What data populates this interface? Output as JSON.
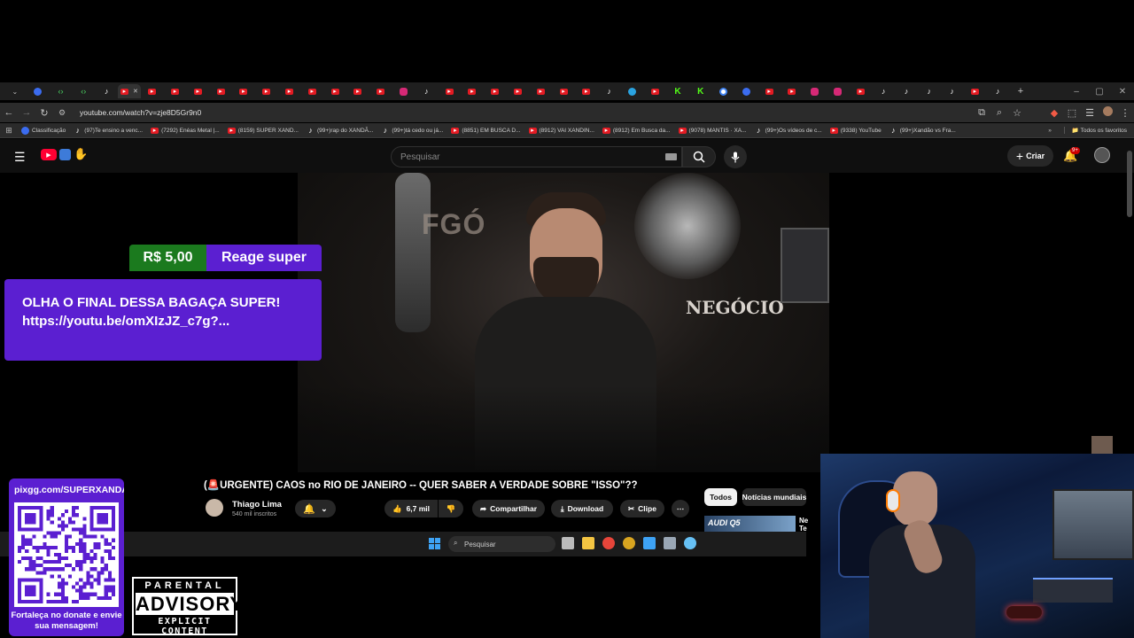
{
  "browser": {
    "tabs": [
      {
        "icon": "chrome-app-icon"
      },
      {
        "icon": "code-icon"
      },
      {
        "icon": "code-icon"
      },
      {
        "icon": "tiktok-icon"
      },
      {
        "icon": "youtube-icon",
        "active": true
      },
      {
        "icon": "youtube-icon"
      },
      {
        "icon": "youtube-icon"
      },
      {
        "icon": "youtube-icon"
      },
      {
        "icon": "youtube-icon"
      },
      {
        "icon": "youtube-icon"
      },
      {
        "icon": "youtube-icon"
      },
      {
        "icon": "youtube-icon"
      },
      {
        "icon": "youtube-icon"
      },
      {
        "icon": "youtube-icon"
      },
      {
        "icon": "youtube-icon"
      },
      {
        "icon": "youtube-icon"
      },
      {
        "icon": "instagram-icon"
      },
      {
        "icon": "tiktok-icon"
      },
      {
        "icon": "youtube-icon"
      },
      {
        "icon": "youtube-icon"
      },
      {
        "icon": "youtube-icon"
      },
      {
        "icon": "youtube-icon"
      },
      {
        "icon": "youtube-icon"
      },
      {
        "icon": "youtube-icon"
      },
      {
        "icon": "youtube-icon"
      },
      {
        "icon": "tiktok-icon"
      },
      {
        "icon": "telegram-icon"
      },
      {
        "icon": "youtube-icon"
      },
      {
        "icon": "kick-icon"
      },
      {
        "icon": "kick-icon"
      },
      {
        "icon": "google-icon"
      },
      {
        "icon": "blue-icon"
      },
      {
        "icon": "youtube-icon"
      },
      {
        "icon": "youtube-icon"
      },
      {
        "icon": "instagram-icon"
      },
      {
        "icon": "instagram-icon"
      },
      {
        "icon": "youtube-icon"
      },
      {
        "icon": "tiktok-icon"
      },
      {
        "icon": "tiktok-icon"
      },
      {
        "icon": "tiktok-icon"
      },
      {
        "icon": "tiktok-icon"
      },
      {
        "icon": "youtube-icon"
      },
      {
        "icon": "tiktok-icon"
      }
    ],
    "url": "youtube.com/watch?v=zje8D5Gr9n0",
    "bookmarks": [
      {
        "icon": "chrome-app-icon",
        "label": "Classificação"
      },
      {
        "icon": "tiktok-icon",
        "label": "(97)Te ensino a venc..."
      },
      {
        "icon": "youtube-icon",
        "label": "(7292) Enéas Metal |..."
      },
      {
        "icon": "youtube-icon",
        "label": "(8159) SUPER XAND..."
      },
      {
        "icon": "tiktok-icon",
        "label": "(99+)rap do XANDÃ..."
      },
      {
        "icon": "tiktok-icon",
        "label": "(99+)tá cedo ou já..."
      },
      {
        "icon": "youtube-icon",
        "label": "(8851) EM BUSCA D..."
      },
      {
        "icon": "youtube-icon",
        "label": "(8912) VAI XANDIN..."
      },
      {
        "icon": "youtube-icon",
        "label": "(8912) Em Busca da..."
      },
      {
        "icon": "youtube-icon",
        "label": "(9078) MANTIS · XA..."
      },
      {
        "icon": "tiktok-icon",
        "label": "(99+)Os vídeos de c..."
      },
      {
        "icon": "youtube-icon",
        "label": "(9338) YouTube"
      },
      {
        "icon": "tiktok-icon",
        "label": "(99+)Xandão vs Fra..."
      }
    ],
    "all_bookmarks": "Todos os favoritos"
  },
  "youtube": {
    "search_placeholder": "Pesquisar",
    "create_label": "Criar",
    "notifications_badge": "9+",
    "video_title": "(🚨URGENTE) CAOS no RIO DE JANEIRO -- QUER SABER A VERDADE SOBRE \"ISSO\"??",
    "video_scene_text": "NEGÓCIO",
    "channel_name": "Thiago Lima",
    "subscribers": "540 mil inscritos",
    "likes": "6,7 mil",
    "share_label": "Compartilhar",
    "download_label": "Download",
    "clip_label": "Clipe",
    "chips": [
      "Todos",
      "Notícias mundiais"
    ],
    "sidebar_thumb_text": "AUDI Q5",
    "sidebar_peek": "Ne\nTe"
  },
  "donation": {
    "amount": "R$ 5,00",
    "name": "Reage super",
    "message": "OLHA O FINAL DESSA BAGAÇA SUPER! https://youtu.be/omXIzJZ_c7g?..."
  },
  "taskbar": {
    "search_placeholder": "Pesquisar",
    "apps": [
      "windows-start-icon",
      "task-view-icon",
      "file-explorer-icon",
      "chrome-icon",
      "chrome-canary-icon",
      "app-blue-icon",
      "settings-icon",
      "steam-icon"
    ]
  },
  "overlay": {
    "pix_url": "pixgg.com/SUPERXANDAO",
    "pix_text": "Fortaleça no donate e envie sua mensagem!",
    "advisory_top": "PARENTAL",
    "advisory_mid": "ADVISORY",
    "advisory_bottom": "EXPLICIT CONTENT"
  },
  "colors": {
    "donation_purple": "#5b1fd1",
    "donation_green": "#1b7a1e",
    "youtube_red": "#ff0033",
    "youtube_bg": "#0f0f0f"
  }
}
